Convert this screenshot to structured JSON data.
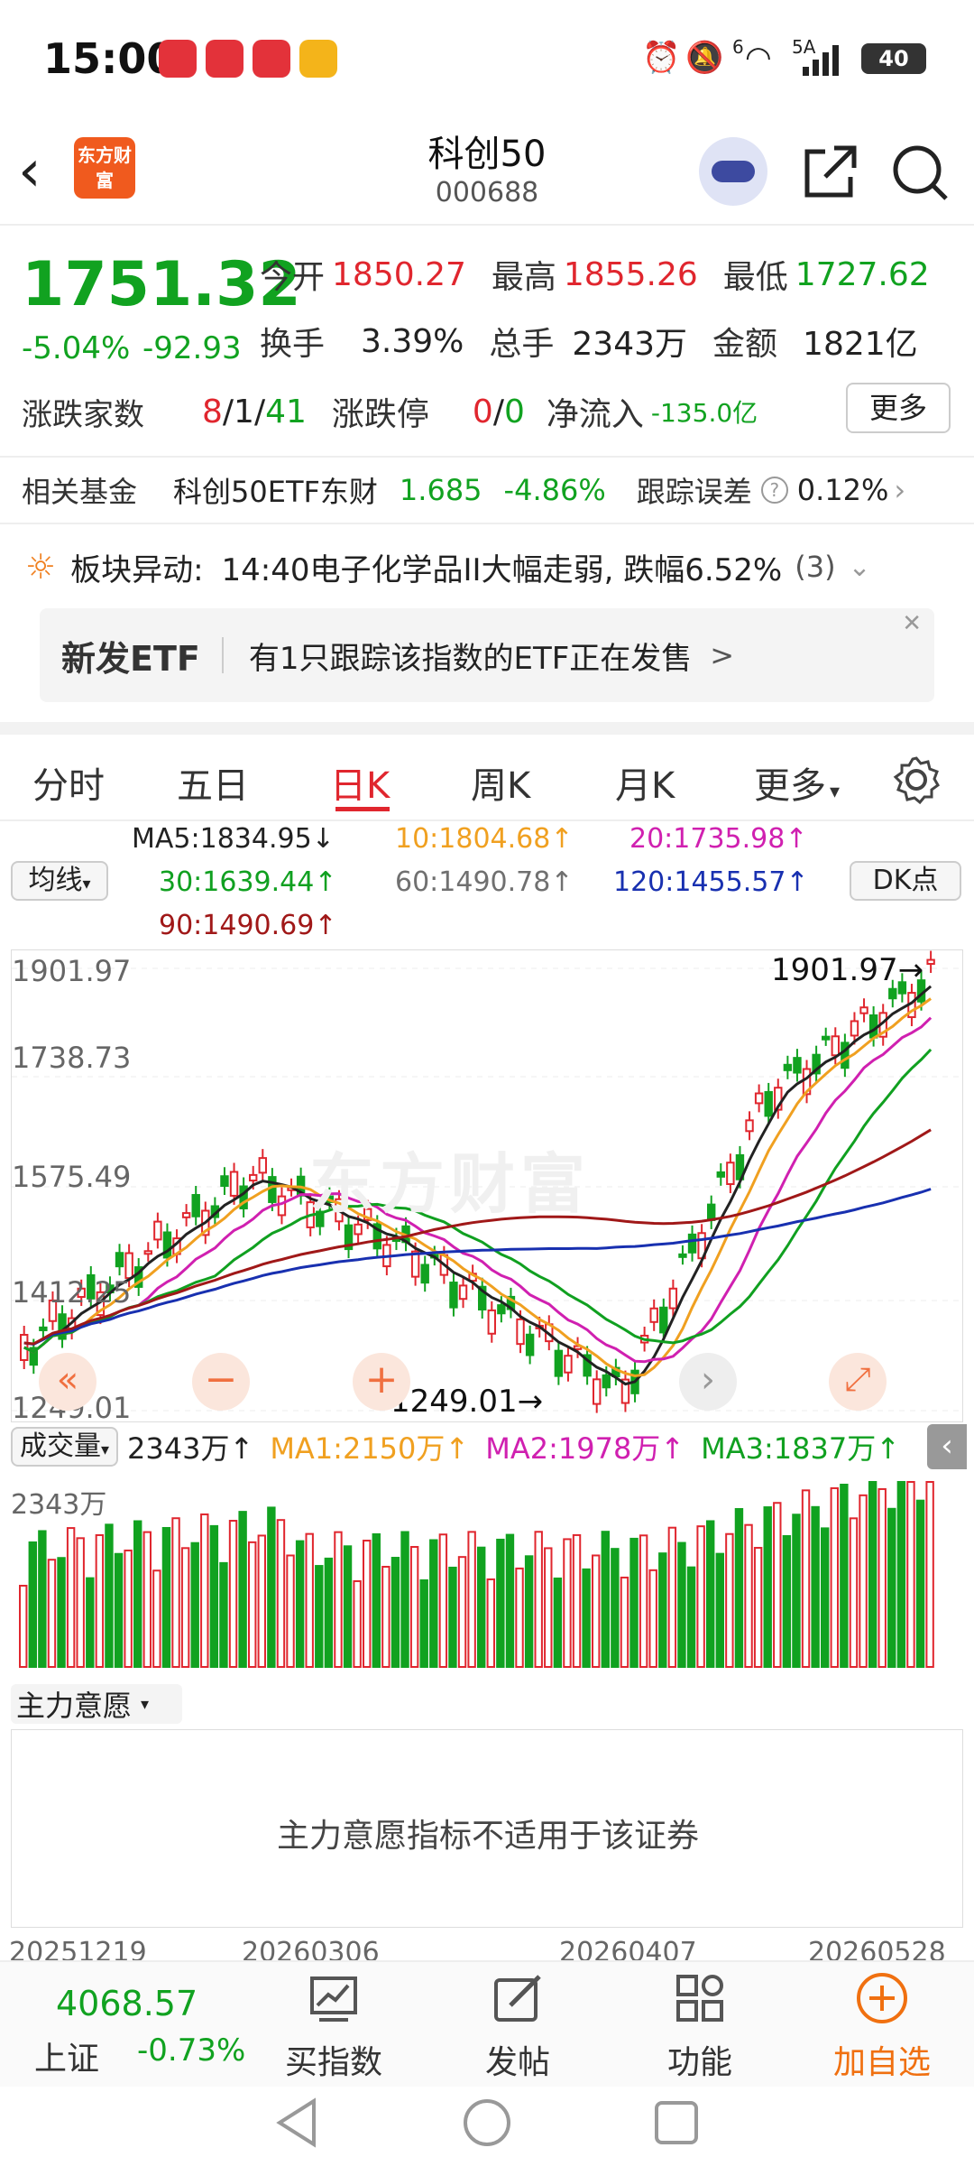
{
  "status": {
    "time": "15:00",
    "signal": "6",
    "network": "5A",
    "battery": "40"
  },
  "header": {
    "logo": "东方财富",
    "title": "科创50",
    "code": "000688"
  },
  "quote": {
    "price": "1751.32",
    "pct": "-5.04%",
    "change": "-92.93",
    "open_label": "今开",
    "open": "1850.27",
    "high_label": "最高",
    "high": "1855.26",
    "low_label": "最低",
    "low": "1727.62",
    "turnover_label": "换手",
    "turnover": "3.39%",
    "volume_label": "总手",
    "volume": "2343万",
    "amount_label": "金额",
    "amount": "1821亿",
    "breadth_label": "涨跌家数",
    "breadth_up": "8",
    "breadth_flat": "1",
    "breadth_down": "41",
    "limit_label": "涨跌停",
    "limit_up": "0",
    "limit_down": "0",
    "netflow_label": "净流入",
    "netflow": "-135.0亿",
    "more": "更多"
  },
  "fund": {
    "label": "相关基金",
    "name": "科创50ETF东财",
    "price": "1.685",
    "pct": "-4.86%",
    "error_label": "跟踪误差",
    "error": "0.12%"
  },
  "alert": {
    "label": "板块异动:",
    "text": "14:40电子化学品II大幅走弱, 跌幅6.52%",
    "count": "(3)"
  },
  "etf_banner": {
    "tag": "新发ETF",
    "text": "有1只跟踪该指数的ETF正在发售",
    "arrow": ">"
  },
  "tabs": [
    "分时",
    "五日",
    "日K",
    "周K",
    "月K",
    "更多"
  ],
  "ma": {
    "selector": "均线",
    "ma5": "MA5:1834.95↓",
    "ma10": "10:1804.68↑",
    "ma20": "20:1735.98↑",
    "ma30": "30:1639.44↑",
    "ma60": "60:1490.78↑",
    "ma120": "120:1455.57↑",
    "ma90": "90:1490.69↑",
    "dk": "DK点",
    "colors": {
      "ma5": "#222222",
      "ma10": "#f0a020",
      "ma20": "#d020b0",
      "ma30": "#10a020",
      "ma60": "#707070",
      "ma120": "#1830b0",
      "ma90": "#a01818"
    }
  },
  "kline": {
    "y_top": "1901.97",
    "y_2": "1738.73",
    "y_3": "1575.49",
    "y_4": "1412.25",
    "y_bottom": "1249.01",
    "high_mark": "1901.97",
    "low_mark": "1249.01",
    "watermark": "东方财富"
  },
  "volume": {
    "selector": "成交量",
    "vol": "2343万↑",
    "ma1": "MA1:2150万↑",
    "ma2": "MA2:1978万↑",
    "ma3": "MA3:1837万↑",
    "y_top": "2343万"
  },
  "zl": {
    "selector": "主力意愿",
    "message": "主力意愿指标不适用于该证券"
  },
  "dates": [
    "20251219",
    "20260306",
    "20260407",
    "20260528"
  ],
  "bottom": {
    "index_price": "4068.57",
    "index_name": "上证",
    "index_pct": "-0.73%",
    "buy_index": "买指数",
    "post": "发帖",
    "function": "功能",
    "add_watch": "加自选"
  }
}
